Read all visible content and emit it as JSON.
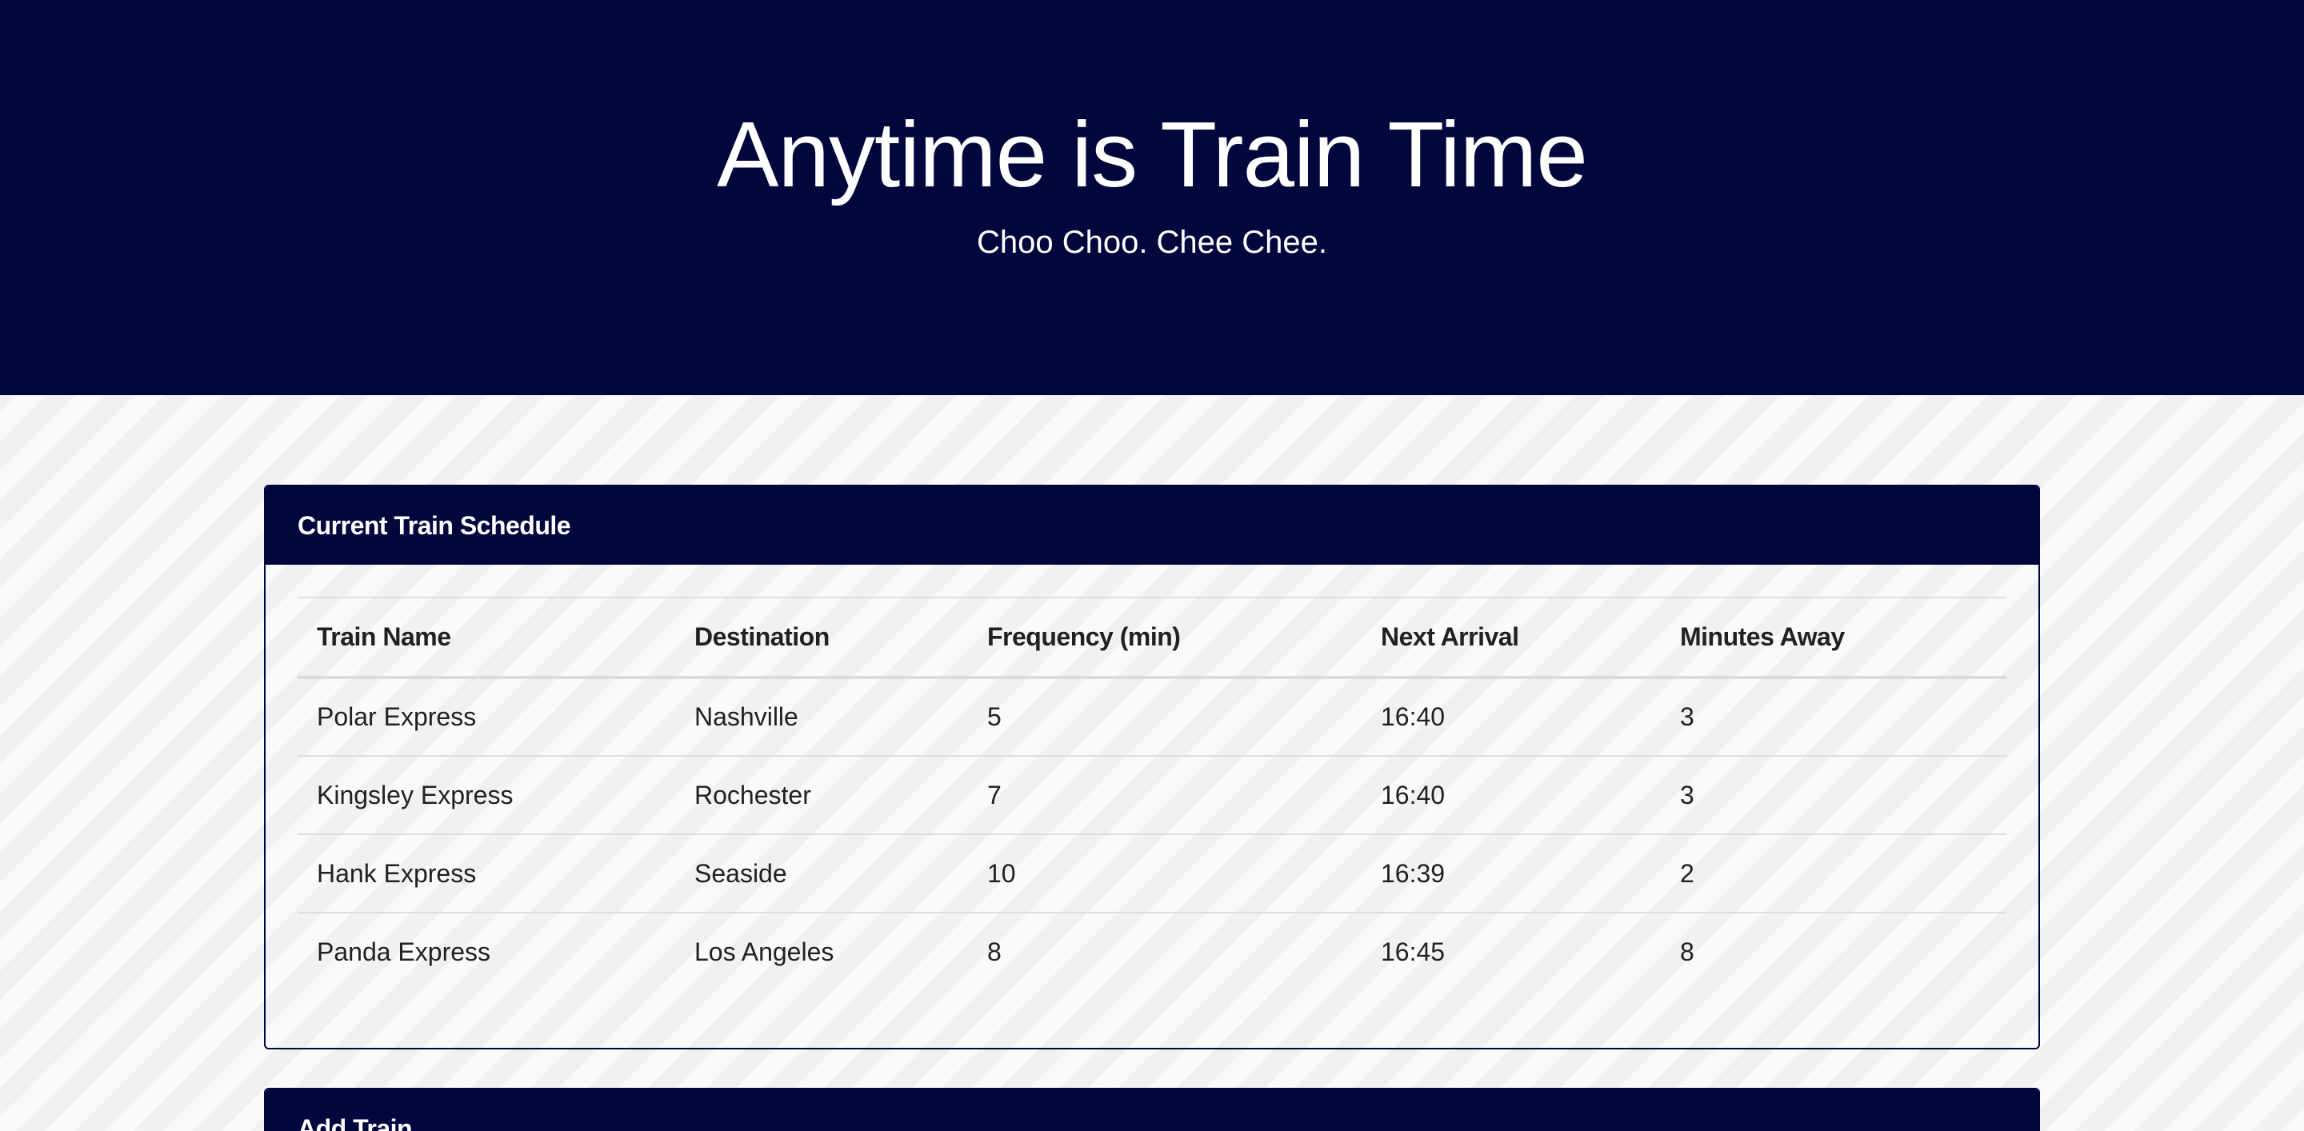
{
  "header": {
    "title": "Anytime is Train Time",
    "subtitle": "Choo Choo. Chee Chee."
  },
  "schedule": {
    "title": "Current Train Schedule",
    "columns": [
      "Train Name",
      "Destination",
      "Frequency (min)",
      "Next Arrival",
      "Minutes Away"
    ],
    "rows": [
      [
        "Polar Express",
        "Nashville",
        "5",
        "16:40",
        "3"
      ],
      [
        "Kingsley Express",
        "Rochester",
        "7",
        "16:40",
        "3"
      ],
      [
        "Hank Express",
        "Seaside",
        "10",
        "16:39",
        "2"
      ],
      [
        "Panda Express",
        "Los Angeles",
        "8",
        "16:45",
        "8"
      ]
    ]
  },
  "add_train": {
    "title": "Add Train"
  },
  "colors": {
    "navy": "#01063d",
    "background": "#f7f7f7"
  }
}
